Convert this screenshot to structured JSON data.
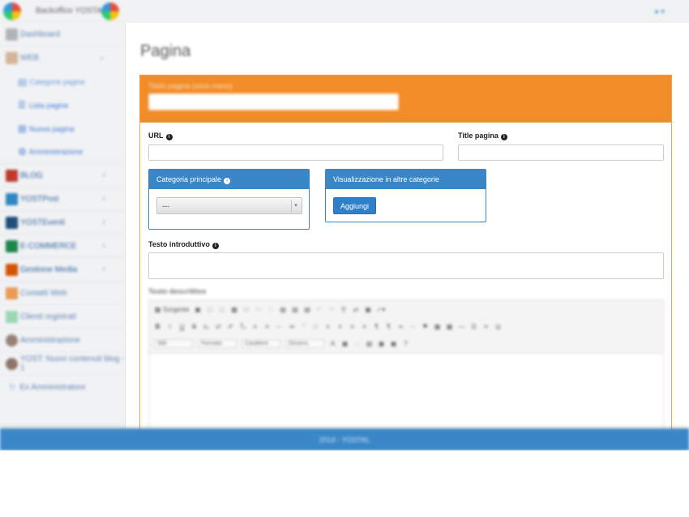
{
  "topbar": {
    "brand": "Backoffice YOSTAL",
    "user_menu": "▾"
  },
  "sidebar": {
    "items": [
      {
        "label": "Dashboard",
        "icon": "dashboard-icon",
        "color": "#9aa0a6",
        "soft": true,
        "chevron": false
      },
      {
        "label": "WEB",
        "icon": "web-icon",
        "color": "#c9a27a",
        "soft": true,
        "chevron": true
      },
      {
        "label": "BLOG",
        "icon": "blog-icon",
        "color": "#c0392b",
        "soft": false,
        "chevron": true
      },
      {
        "label": "YOSTPost",
        "icon": "grid-icon",
        "color": "#2e86c1",
        "soft": false,
        "chevron": true
      },
      {
        "label": "YOSTEventi",
        "icon": "events-icon",
        "color": "#1f4e79",
        "soft": false,
        "chevron": true
      },
      {
        "label": "E-COMMERCE",
        "icon": "cart-icon",
        "color": "#1e8449",
        "soft": false,
        "chevron": true
      },
      {
        "label": "Gestione Media",
        "icon": "media-icon",
        "color": "#d35400",
        "soft": false,
        "chevron": true
      },
      {
        "label": "Contatti Web",
        "icon": "mail-icon",
        "color": "#e67e22",
        "soft": true,
        "chevron": false
      },
      {
        "label": "Clienti registrati",
        "icon": "clients-icon",
        "color": "#7dcea0",
        "soft": true,
        "chevron": false
      },
      {
        "label": "Amministrazione",
        "icon": "admin-user-icon",
        "color": "#7b5a4a",
        "soft": true,
        "chevron": false
      },
      {
        "label": "YOST: Nuovi contenuti blog - 1",
        "icon": "avatar-icon",
        "color": "#6e4b3a",
        "soft": true,
        "chevron": false
      },
      {
        "label": "Ex Amministratore",
        "icon": "refresh-icon",
        "color": "#5d9cec",
        "soft": true,
        "chevron": false
      }
    ],
    "web_sub": [
      {
        "label": "Categorie pagine",
        "icon": "list-alt-icon",
        "soft": true
      },
      {
        "label": "Lista pagine",
        "icon": "list-icon",
        "soft": false
      },
      {
        "label": "Nuova pagina",
        "icon": "plus-square-icon",
        "soft": false
      },
      {
        "label": "Amministrazione",
        "icon": "gears-icon",
        "soft": false
      }
    ]
  },
  "main": {
    "title": "Pagina",
    "header_field_label": "Titolo pagina (voce menu)",
    "url_label": "URL",
    "title_label": "Title pagina",
    "category_panel": {
      "title": "Categoria principale",
      "selected": "---"
    },
    "other_categories_panel": {
      "title": "Visualizzazione in altre categorie",
      "button": "Aggiungi"
    },
    "intro_label": "Testo introduttivo",
    "desc_label": "Testo descrittivo",
    "toolbar": {
      "source_label": "Sorgente",
      "dropdowns": [
        "Stili",
        "Formato",
        "Carattere",
        "Dimens."
      ]
    }
  },
  "footer": {
    "text": "2014 - YOSTAL"
  },
  "colors": {
    "accent_orange": "#f28c28",
    "accent_blue": "#3a87c8"
  }
}
